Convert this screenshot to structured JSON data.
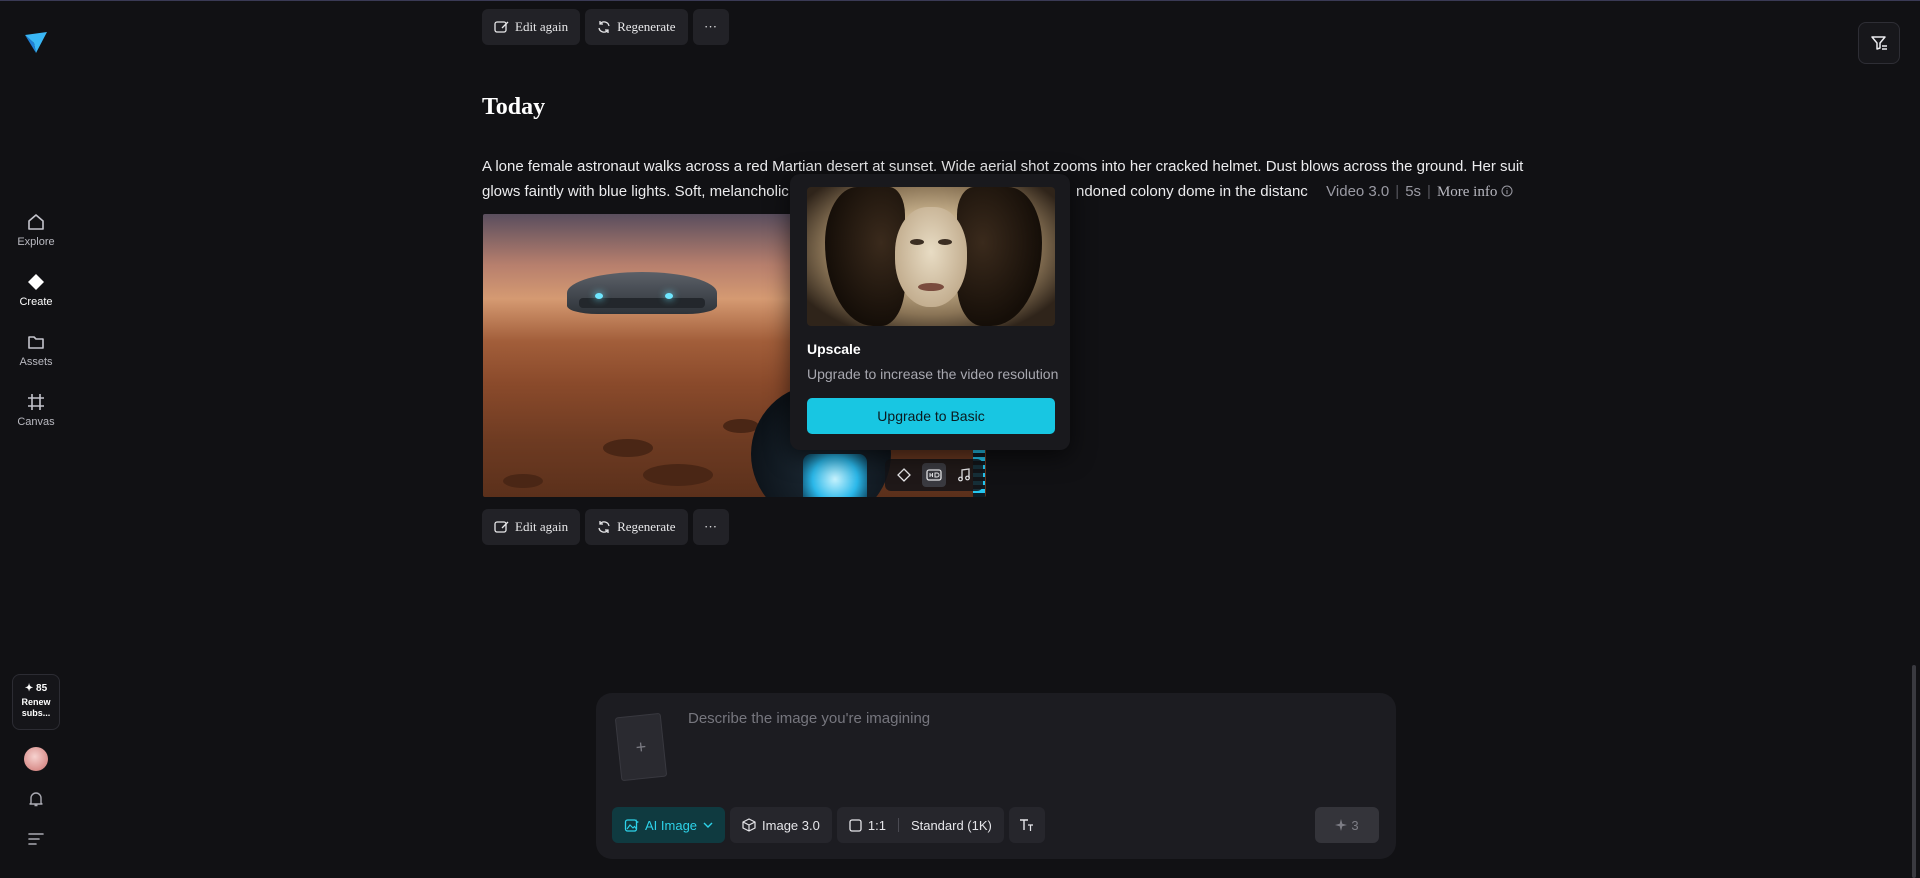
{
  "nav": {
    "items": [
      {
        "label": "Explore",
        "icon": "home-icon"
      },
      {
        "label": "Create",
        "icon": "diamond-icon"
      },
      {
        "label": "Assets",
        "icon": "folder-icon"
      },
      {
        "label": "Canvas",
        "icon": "canvas-icon"
      }
    ],
    "credits": {
      "amount": "✦ 85",
      "renew_line1": "Renew",
      "renew_line2": "subs..."
    }
  },
  "actions": {
    "edit_again": "Edit again",
    "regenerate": "Regenerate",
    "more": "···"
  },
  "feed": {
    "section_title": "Today",
    "prompt_line1": "A lone female astronaut walks across a red Martian desert at sunset. Wide aerial shot zooms into her cracked helmet. Dust blows across the ground. Her suit",
    "prompt_line2_start": "glows faintly with blue lights. Soft, melancholic r",
    "prompt_line2_end": "ndoned colony dome in the distanc",
    "model": "Video 3.0",
    "duration": "5s",
    "more_info": "More info"
  },
  "popover": {
    "title": "Upscale",
    "description": "Upgrade to increase the video resolution",
    "button": "Upgrade to Basic"
  },
  "composer": {
    "placeholder": "Describe the image you're imagining",
    "mode": "AI Image",
    "model": "Image 3.0",
    "ratio": "1:1",
    "quality": "Standard (1K)",
    "cost": "3"
  },
  "colors": {
    "accent": "#18c6e2",
    "background": "#111114",
    "panel": "#1c1c21"
  }
}
